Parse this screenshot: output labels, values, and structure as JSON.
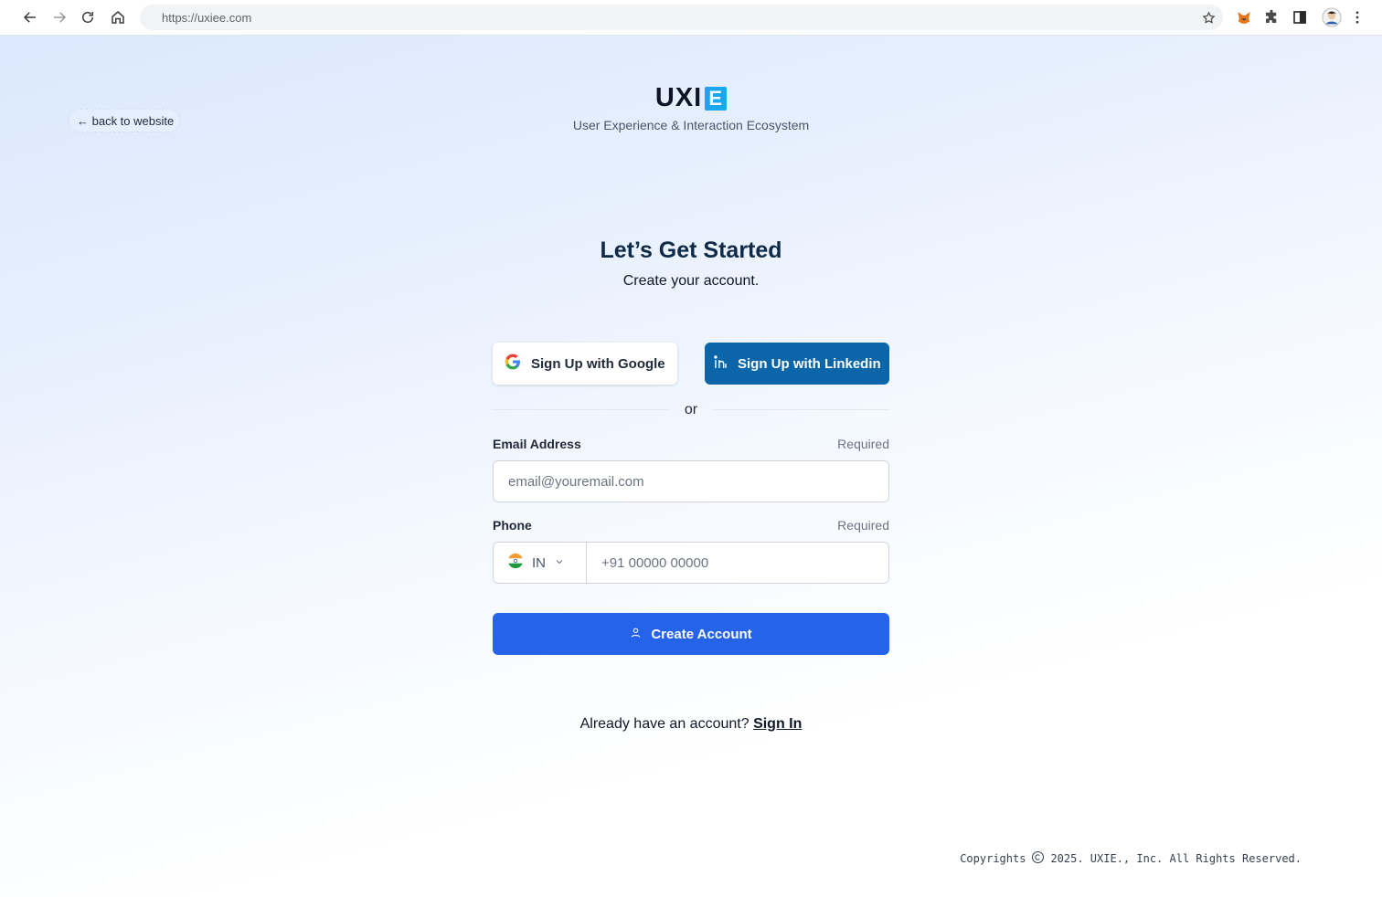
{
  "browser": {
    "url": "https://uxiee.com",
    "icons": [
      "back-arrow-icon",
      "forward-arrow-icon",
      "reload-icon",
      "home-icon",
      "star-icon",
      "fox-extension-icon",
      "puzzle-extension-icon",
      "side-panel-icon",
      "profile-avatar",
      "more-menu-icon"
    ]
  },
  "page": {
    "back_link": "← back to website",
    "logo": {
      "text": "UXI",
      "highlight": "E",
      "accent_color": "#19a7ef"
    },
    "tagline": "User Experience & Interaction Ecosystem",
    "heading": "Let’s Get Started",
    "subheading": "Create your account.",
    "social": {
      "google_label": "Sign Up with Google",
      "linkedin_label": "Sign Up with Linkedin",
      "linkedin_color": "#0a66a8"
    },
    "divider": "or",
    "email": {
      "label": "Email Address",
      "required": "Required",
      "placeholder": "email@youremail.com"
    },
    "phone": {
      "label": "Phone",
      "required": "Required",
      "country_code": "IN",
      "placeholder": "+91 00000 00000"
    },
    "create_button": {
      "label": "Create Account",
      "color": "#2563eb"
    },
    "signin": {
      "prompt": "Already have an account?",
      "link": "Sign In"
    },
    "footer": {
      "copyright_prefix": "Copyrights",
      "copyright_suffix": "2025. UXIE., Inc. All Rights Reserved."
    }
  }
}
